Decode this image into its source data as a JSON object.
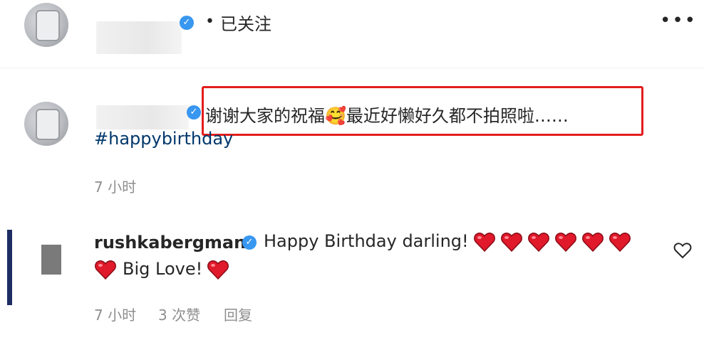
{
  "header": {
    "follow_separator": "•",
    "follow_status": "已关注",
    "more_icon": "more-icon"
  },
  "caption": {
    "text": "谢谢大家的祝福🥰最近好懒好久都不拍照啦……",
    "hashtag": "#happybirthday",
    "time": "7 小时"
  },
  "reply": {
    "username": "rushkabergman",
    "text_line1": "Happy Birthday darling!",
    "hearts_line1": 6,
    "hearts_line2_before": 1,
    "text_line2": "Big Love!",
    "hearts_line2_after": 1,
    "time": "7 小时",
    "likes": "3 次赞",
    "reply_label": "回复"
  },
  "colors": {
    "verified": "#3897f0",
    "highlight": "#e31d1d",
    "heart": "#e0192b",
    "hashtag": "#00376b"
  }
}
